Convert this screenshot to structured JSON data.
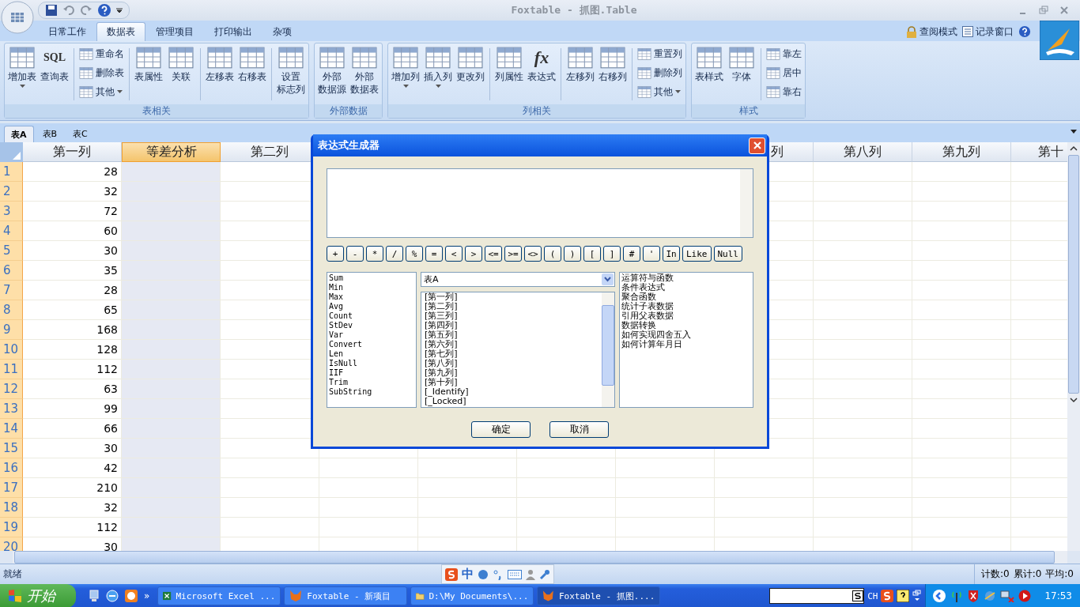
{
  "window": {
    "title": "Foxtable - 抓图.Table"
  },
  "ribbon_tabs": [
    {
      "label": "日常工作",
      "selected": false
    },
    {
      "label": "数据表",
      "selected": true
    },
    {
      "label": "管理项目",
      "selected": false
    },
    {
      "label": "打印输出",
      "selected": false
    },
    {
      "label": "杂项",
      "selected": false
    }
  ],
  "ribbon_right": [
    {
      "label": "查阅模式",
      "kind": "lock"
    },
    {
      "label": "记录窗口",
      "kind": "list"
    }
  ],
  "ribbon_groups": [
    {
      "label": "表相关",
      "items": [
        {
          "kind": "large",
          "label": "增加表",
          "dropdown": true
        },
        {
          "kind": "large",
          "label": "查询表",
          "icon_text": "SQL"
        },
        {
          "kind": "separator"
        },
        {
          "kind": "stack",
          "items": [
            {
              "label": "重命名",
              "dropdown": false
            },
            {
              "label": "删除表",
              "dropdown": false
            },
            {
              "label": "其他",
              "dropdown": true
            }
          ]
        },
        {
          "kind": "separator"
        },
        {
          "kind": "large",
          "label": "表属性"
        },
        {
          "kind": "large",
          "label": "关联"
        },
        {
          "kind": "separator"
        },
        {
          "kind": "large",
          "label": "左移表"
        },
        {
          "kind": "large",
          "label": "右移表"
        },
        {
          "kind": "separator"
        },
        {
          "kind": "large",
          "lines": [
            "设置",
            "标志列"
          ]
        }
      ]
    },
    {
      "label": "外部数据",
      "items": [
        {
          "kind": "large",
          "lines": [
            "外部",
            "数据源"
          ]
        },
        {
          "kind": "large",
          "lines": [
            "外部",
            "数据表"
          ]
        }
      ]
    },
    {
      "label": "列相关",
      "items": [
        {
          "kind": "large",
          "label": "增加列",
          "dropdown": true
        },
        {
          "kind": "large",
          "label": "插入列",
          "dropdown": true
        },
        {
          "kind": "large",
          "label": "更改列"
        },
        {
          "kind": "separator"
        },
        {
          "kind": "large",
          "label": "列属性"
        },
        {
          "kind": "large",
          "label": "表达式",
          "icon_text": "fx"
        },
        {
          "kind": "separator"
        },
        {
          "kind": "large",
          "label": "左移列"
        },
        {
          "kind": "large",
          "label": "右移列"
        },
        {
          "kind": "separator"
        },
        {
          "kind": "stack",
          "items": [
            {
              "label": "重置列",
              "dropdown": false
            },
            {
              "label": "删除列",
              "dropdown": false
            },
            {
              "label": "其他",
              "dropdown": true
            }
          ]
        }
      ]
    },
    {
      "label": "样式",
      "items": [
        {
          "kind": "large",
          "label": "表样式"
        },
        {
          "kind": "large",
          "label": "字体"
        },
        {
          "kind": "separator"
        },
        {
          "kind": "stack",
          "items": [
            {
              "label": "靠左",
              "dropdown": false
            },
            {
              "label": "居中",
              "dropdown": false
            },
            {
              "label": "靠右",
              "dropdown": false
            }
          ]
        }
      ]
    }
  ],
  "sheet_tabs": [
    {
      "label": "表A",
      "selected": true
    },
    {
      "label": "表B",
      "selected": false
    },
    {
      "label": "表C",
      "selected": false
    }
  ],
  "grid": {
    "columns": [
      {
        "label": "第一列",
        "selected": false
      },
      {
        "label": "等差分析",
        "selected": true
      },
      {
        "label": "第二列",
        "selected": false
      },
      {
        "selected": false
      },
      {
        "selected": false
      },
      {
        "selected": false
      },
      {
        "selected": false
      },
      {
        "label": "列",
        "selected": false
      },
      {
        "label": "第八列",
        "selected": false
      },
      {
        "label": "第九列",
        "selected": false
      },
      {
        "label": "第十",
        "selected": false
      }
    ],
    "rows": [
      {
        "number": "1",
        "value": "28"
      },
      {
        "number": "2",
        "value": "32"
      },
      {
        "number": "3",
        "value": "72"
      },
      {
        "number": "4",
        "value": "60"
      },
      {
        "number": "5",
        "value": "30"
      },
      {
        "number": "6",
        "value": "35"
      },
      {
        "number": "7",
        "value": "28"
      },
      {
        "number": "8",
        "value": "65"
      },
      {
        "number": "9",
        "value": "168"
      },
      {
        "number": "10",
        "value": "128"
      },
      {
        "number": "11",
        "value": "112"
      },
      {
        "number": "12",
        "value": "63"
      },
      {
        "number": "13",
        "value": "99"
      },
      {
        "number": "14",
        "value": "66"
      },
      {
        "number": "15",
        "value": "30"
      },
      {
        "number": "16",
        "value": "42"
      },
      {
        "number": "17",
        "value": "210"
      },
      {
        "number": "18",
        "value": "32"
      },
      {
        "number": "19",
        "value": "112"
      },
      {
        "number": "20",
        "value": "30"
      }
    ]
  },
  "dialog": {
    "title": "表达式生成器",
    "operators": [
      "+",
      "-",
      "*",
      "/",
      "%",
      "=",
      "<",
      ">",
      "<=",
      ">=",
      "<>",
      "(",
      ")",
      "[",
      "]",
      "#",
      "'",
      "In",
      "Like",
      "Null"
    ],
    "functions": [
      "Sum",
      "Min",
      "Max",
      "Avg",
      "Count",
      "StDev",
      "Var",
      "Convert",
      "Len",
      "IsNull",
      "IIF",
      "Trim",
      "SubString"
    ],
    "table_select": "表A",
    "fields": [
      "[第一列]",
      "[第二列]",
      "[第三列]",
      "[第四列]",
      "[第五列]",
      "[第六列]",
      "[第七列]",
      "[第八列]",
      "[第九列]",
      "[第十列]",
      "[_Identify]",
      "[_Locked]"
    ],
    "topics": [
      "运算符与函数",
      "条件表达式",
      "聚合函数",
      "统计子表数据",
      "引用父表数据",
      "数据转换",
      "如何实现四舍五入",
      "如何计算年月日"
    ],
    "buttons": [
      "确定",
      "取消"
    ]
  },
  "status_bar": {
    "text": "就绪",
    "ime": "中",
    "summary": [
      "计数:0",
      "累计:0",
      "平均:0"
    ]
  },
  "taskbar": {
    "start": "开始",
    "more": "»",
    "tasks": [
      {
        "label": "Microsoft Excel ...",
        "kind": "excel",
        "selected": false
      },
      {
        "label": "Foxtable - 新项目",
        "kind": "app",
        "selected": false
      },
      {
        "label": "D:\\My Documents\\...",
        "kind": "folder",
        "selected": false
      },
      {
        "label": "Foxtable - 抓图....",
        "kind": "app",
        "selected": true
      }
    ],
    "language": "CH",
    "clock": "17:53"
  }
}
